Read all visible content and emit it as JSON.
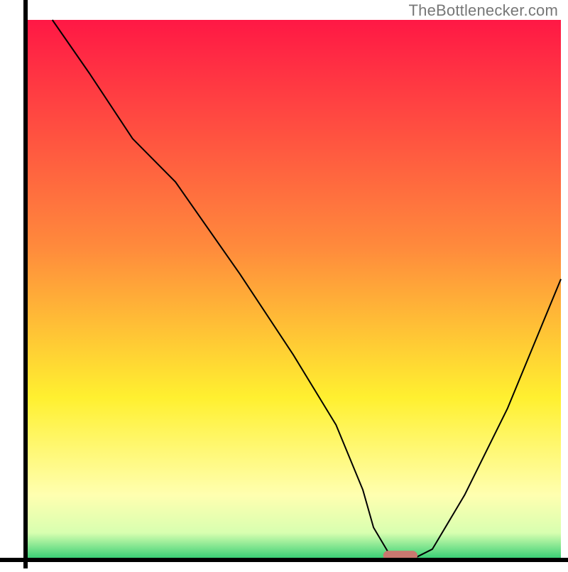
{
  "watermark": "TheBottlenecker.com",
  "chart_data": {
    "type": "line",
    "xlim": [
      0,
      100
    ],
    "ylim": [
      0,
      100
    ],
    "grid": false,
    "title": "",
    "xlabel": "",
    "ylabel": "",
    "background_gradient": [
      {
        "offset": 0,
        "color": "#ff1845"
      },
      {
        "offset": 42,
        "color": "#ff8a3c"
      },
      {
        "offset": 70,
        "color": "#fff030"
      },
      {
        "offset": 88,
        "color": "#ffffb0"
      },
      {
        "offset": 95,
        "color": "#d8ffb0"
      },
      {
        "offset": 100,
        "color": "#2ecc71"
      }
    ],
    "series": [
      {
        "name": "bottleneck-curve",
        "color": "#000000",
        "width": 2,
        "x": [
          5,
          12,
          20,
          28,
          40,
          50,
          58,
          63,
          65,
          68,
          71,
          73,
          76,
          82,
          90,
          100
        ],
        "y": [
          100,
          90,
          78,
          70,
          53,
          38,
          25,
          13,
          6,
          1,
          0.5,
          0.5,
          2,
          12,
          28,
          52
        ]
      }
    ],
    "marker": {
      "name": "optimal-zone-marker",
      "color": "#c9786f",
      "x": 70,
      "y": 0.8,
      "rx": 3.2,
      "ry": 0.9
    }
  }
}
